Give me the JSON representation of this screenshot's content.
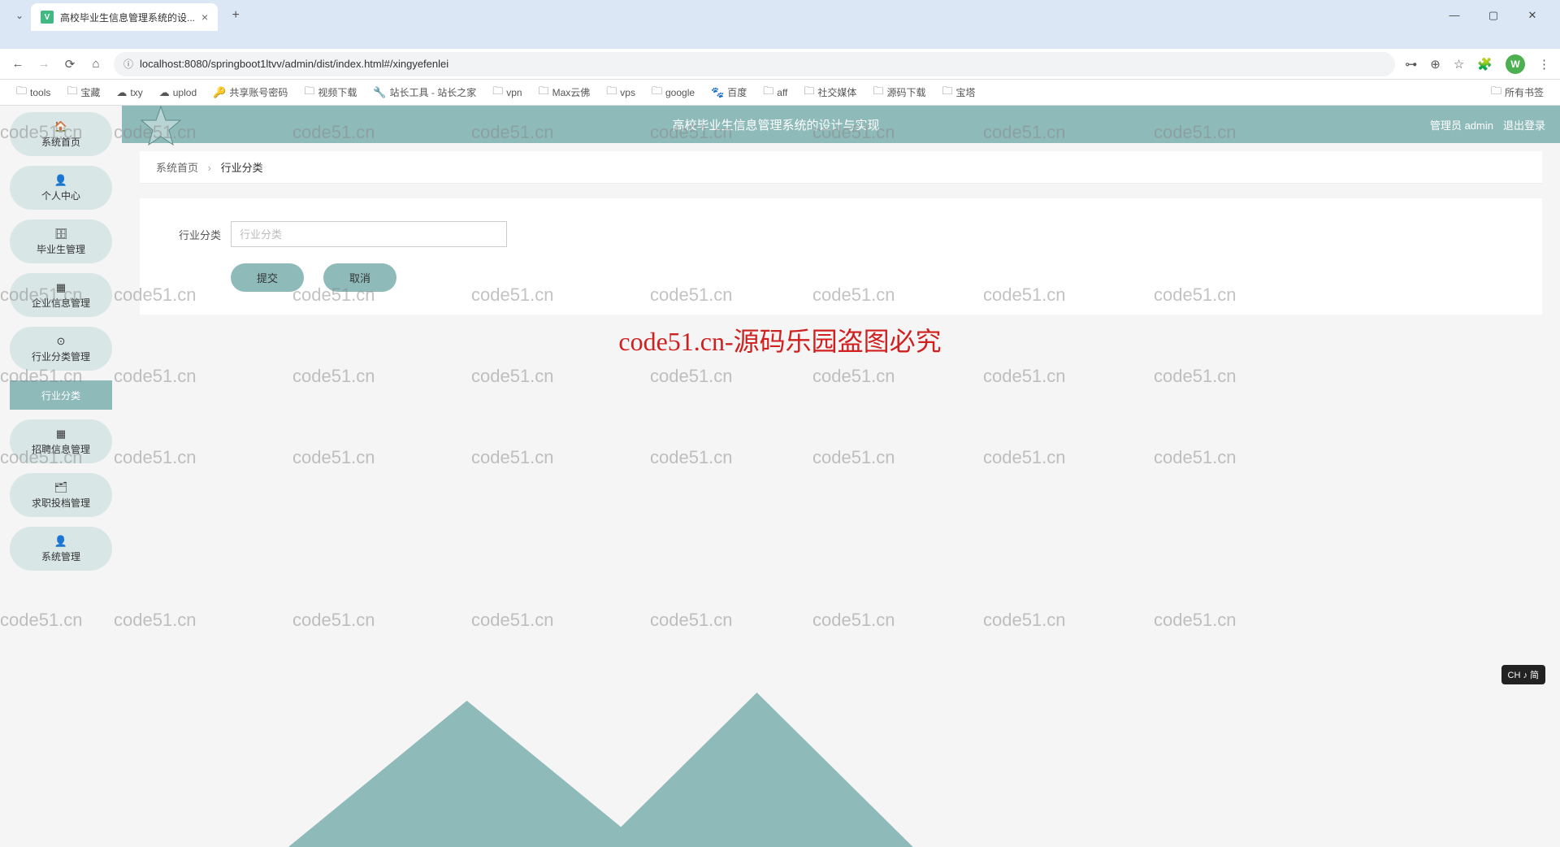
{
  "browser": {
    "tab_title": "高校毕业生信息管理系统的设...",
    "url": "localhost:8080/springboot1ltvv/admin/dist/index.html#/xingyefenlei",
    "avatar_letter": "W",
    "bookmarks": [
      "tools",
      "宝藏",
      "txy",
      "uplod",
      "共享账号密码",
      "视频下载",
      "站长工具 - 站长之家",
      "vpn",
      "Max云佛",
      "vps",
      "google",
      "百度",
      "aff",
      "社交媒体",
      "源码下载",
      "宝塔"
    ],
    "all_bookmarks": "所有书签"
  },
  "sidebar": {
    "items": [
      {
        "icon": "🏠",
        "label": "系统首页"
      },
      {
        "icon": "👤",
        "label": "个人中心"
      },
      {
        "icon": "🗄",
        "label": "毕业生管理"
      },
      {
        "icon": "▦",
        "label": "企业信息管理"
      },
      {
        "icon": "⊙",
        "label": "行业分类管理"
      },
      {
        "icon": "",
        "label": "行业分类",
        "sub": true
      },
      {
        "icon": "▦",
        "label": "招聘信息管理"
      },
      {
        "icon": "🗂",
        "label": "求职投档管理"
      },
      {
        "icon": "👤",
        "label": "系统管理"
      }
    ]
  },
  "header": {
    "title": "高校毕业生信息管理系统的设计与实现",
    "user": "管理员 admin",
    "logout": "退出登录"
  },
  "breadcrumb": {
    "home": "系统首页",
    "current": "行业分类"
  },
  "form": {
    "label": "行业分类",
    "placeholder": "行业分类",
    "submit": "提交",
    "cancel": "取消"
  },
  "watermark": {
    "text": "code51.cn",
    "center": "code51.cn-源码乐园盗图必究"
  },
  "ime": "CH ♪ 简"
}
